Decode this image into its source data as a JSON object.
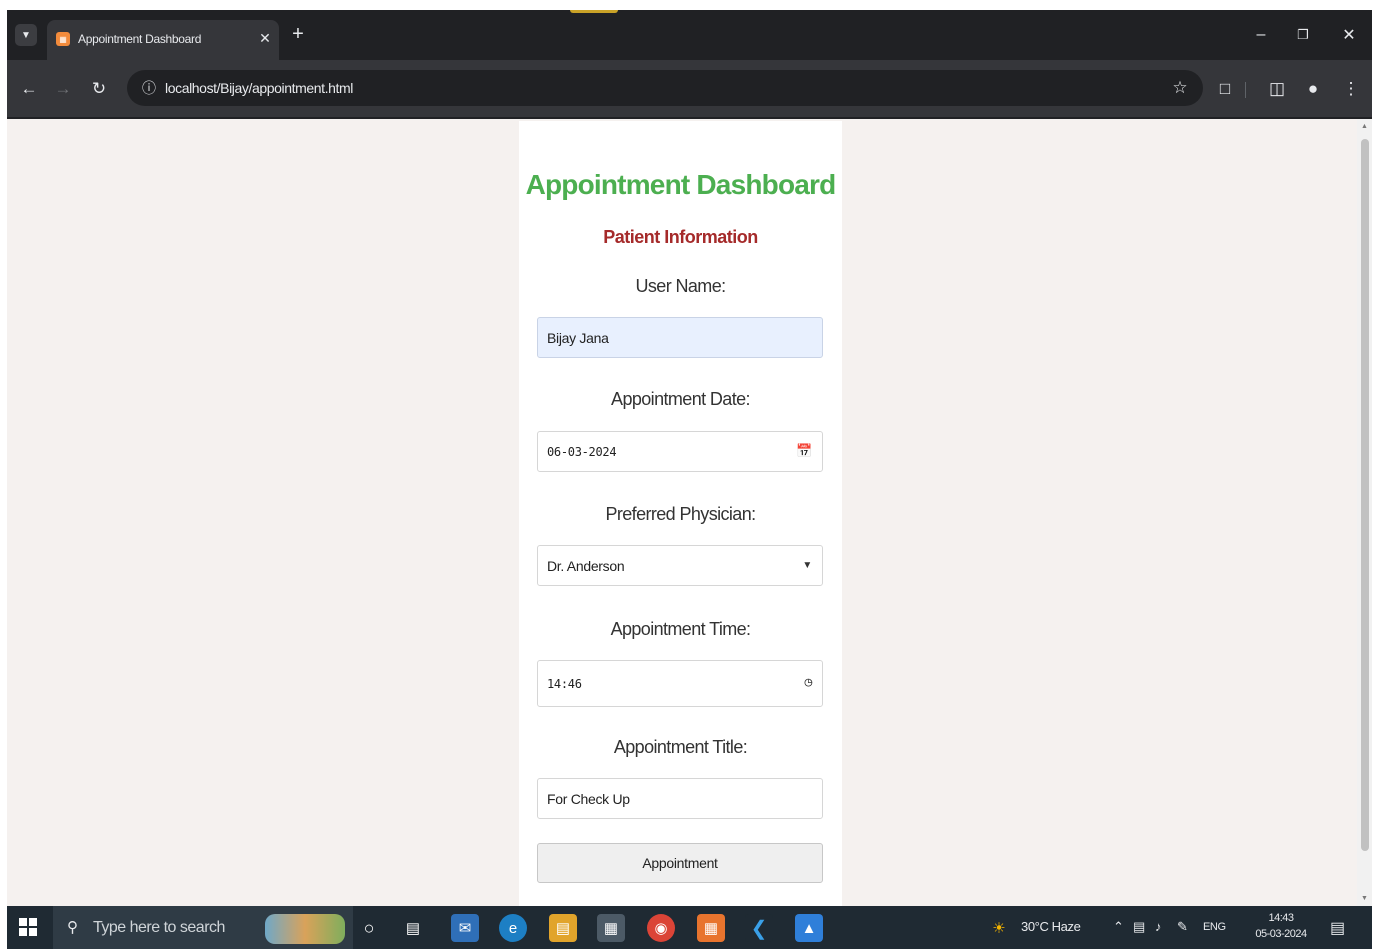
{
  "browser": {
    "tab_title": "Appointment Dashboard",
    "url": "localhost/Bijay/appointment.html"
  },
  "page": {
    "title": "Appointment Dashboard",
    "subtitle": "Patient Information",
    "fields": {
      "user_name": {
        "label": "User Name:",
        "value": "Bijay Jana"
      },
      "appointment_date": {
        "label": "Appointment Date:",
        "value": "06-03-2024"
      },
      "physician": {
        "label": "Preferred Physician:",
        "value": "Dr. Anderson"
      },
      "appointment_time": {
        "label": "Appointment Time:",
        "value": "14:46"
      },
      "appointment_title": {
        "label": "Appointment Title:",
        "value": "For Check Up"
      }
    },
    "submit_label": "Appointment"
  },
  "taskbar": {
    "search_placeholder": "Type here to search",
    "weather": "30°C Haze",
    "language": "ENG",
    "time": "14:43",
    "date": "05-03-2024"
  },
  "colors": {
    "title": "#4caf50",
    "subtitle": "#a52a2a",
    "page_background": "#f5f1ef",
    "autofill_background": "#e8f0fe"
  }
}
